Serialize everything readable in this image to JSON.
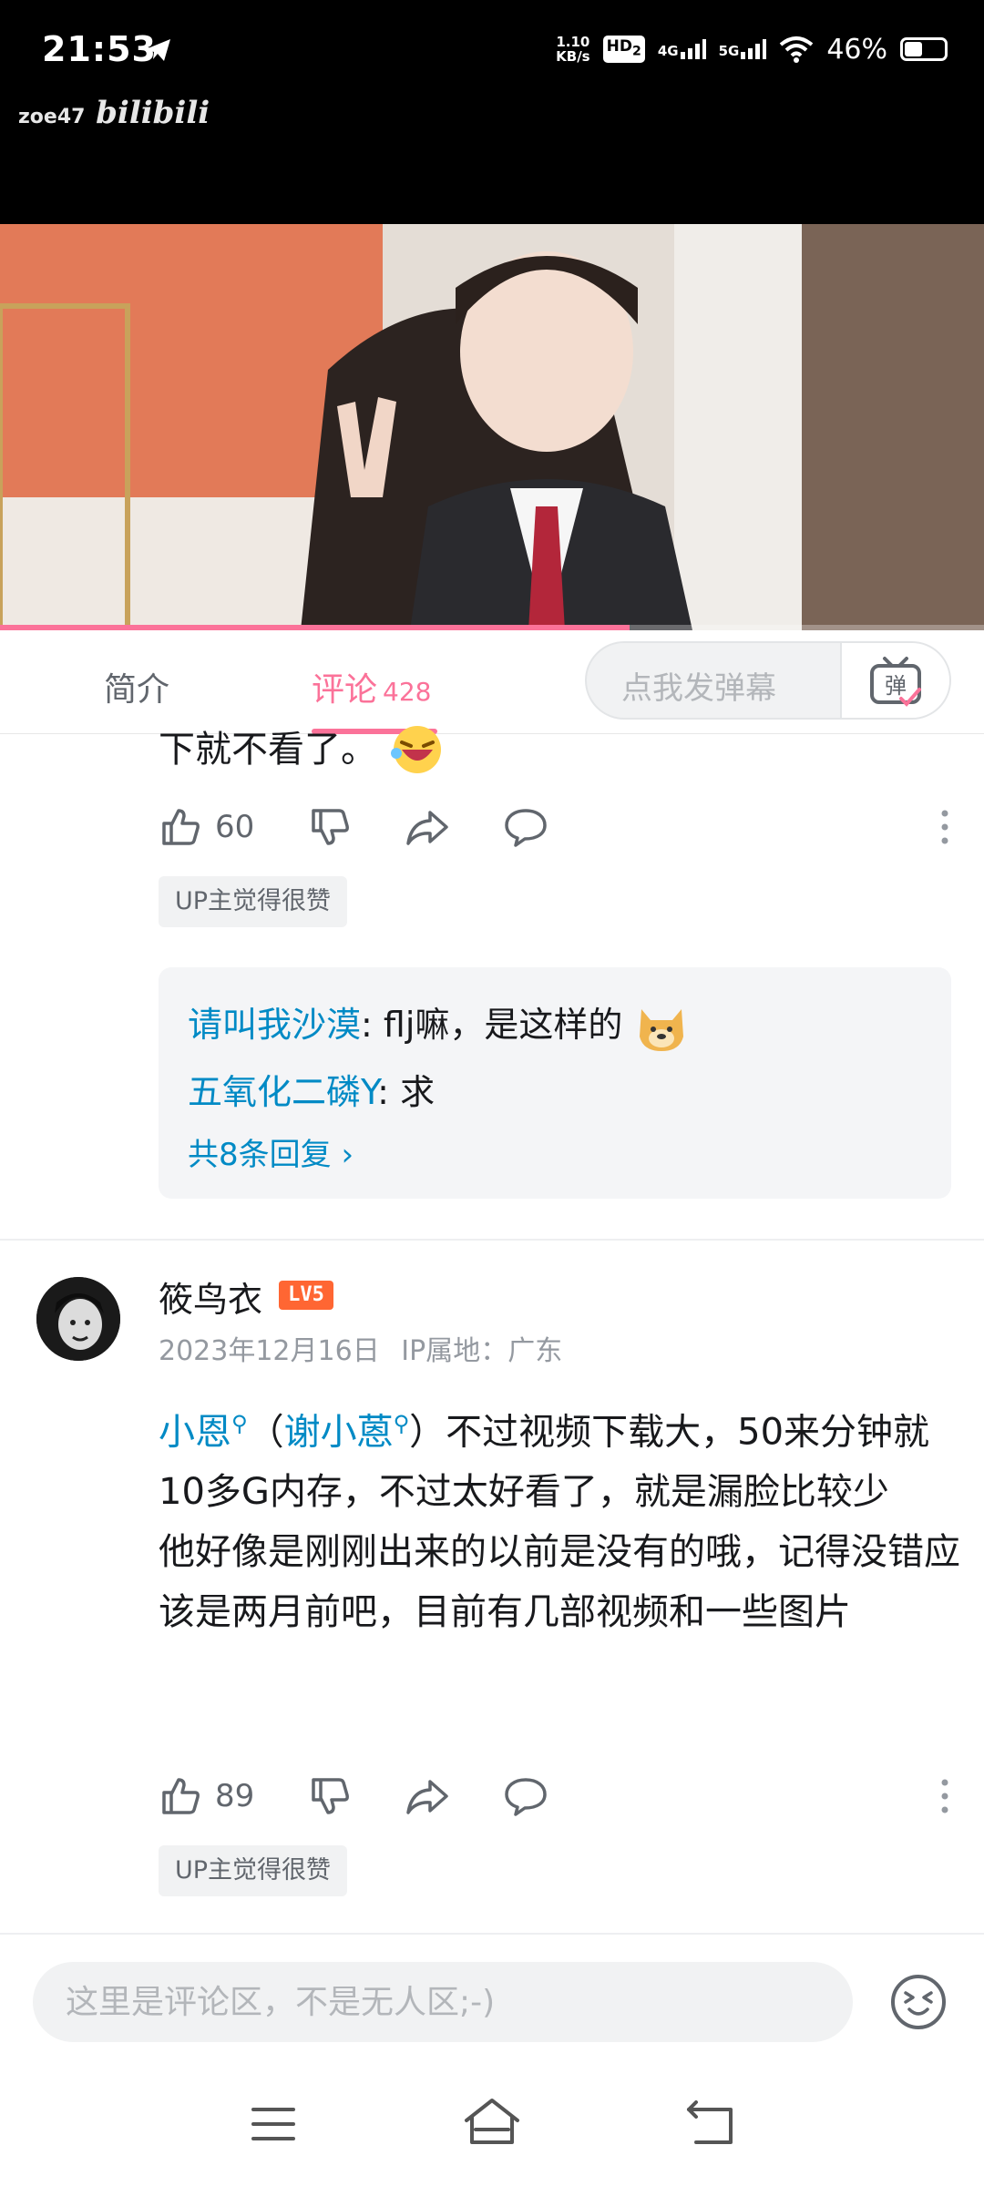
{
  "status_bar": {
    "time": "21:53",
    "net_speed_value": "1.10",
    "net_speed_unit": "KB/s",
    "hd_label": "HD",
    "hd_sub": "2",
    "signal_1": "4G",
    "signal_2": "5G",
    "battery": "46%",
    "battery_level": 0.46
  },
  "video": {
    "uploader_watermark": "zoe47",
    "brand_watermark": "bilibili",
    "progress": 0.64
  },
  "tabs": {
    "intro": "简介",
    "comments": "评论",
    "comments_count": "428",
    "danmaku_placeholder": "点我发弹幕",
    "danmaku_button_label": "弹"
  },
  "comment_1": {
    "text_tail": "下就不看了。",
    "likes": "60",
    "up_badge": "UP主觉得很赞",
    "replies": [
      {
        "user": "请叫我沙漠",
        "sep": ": ",
        "text": "flj嘛，是这样的"
      },
      {
        "user": "五氧化二磷Y",
        "sep": ": ",
        "text": "求"
      }
    ],
    "more_replies": "共8条回复 ›"
  },
  "comment_2": {
    "username": "筱鸟衣",
    "level": "LV5",
    "date": "2023年12月16日",
    "ip_location": "IP属地：广东",
    "mention_1": "小恩",
    "paren_open": "（",
    "mention_2": "谢小蒽",
    "paren_close": "）",
    "text_rest": "不过视频下载大，50来分钟就10多G内存，不过太好看了，就是漏脸比较少",
    "text_line_2": "他好像是刚刚出来的以前是没有的哦，记得没错应该是两月前吧，目前有几部视频和一些图片",
    "likes": "89",
    "up_badge": "UP主觉得很赞"
  },
  "input": {
    "placeholder": "这里是评论区，不是无人区;-)"
  },
  "colors": {
    "brand_pink": "#fb7299",
    "link_blue": "#008ac5",
    "level_orange": "#ff6633"
  },
  "icons": [
    "telegram-icon",
    "wifi-icon",
    "thumbs-up-icon",
    "thumbs-down-icon",
    "share-icon",
    "reply-bubble-icon",
    "more-vertical-icon",
    "emoji-icon",
    "tv-danmaku-icon",
    "menu-icon",
    "home-icon",
    "back-icon"
  ]
}
